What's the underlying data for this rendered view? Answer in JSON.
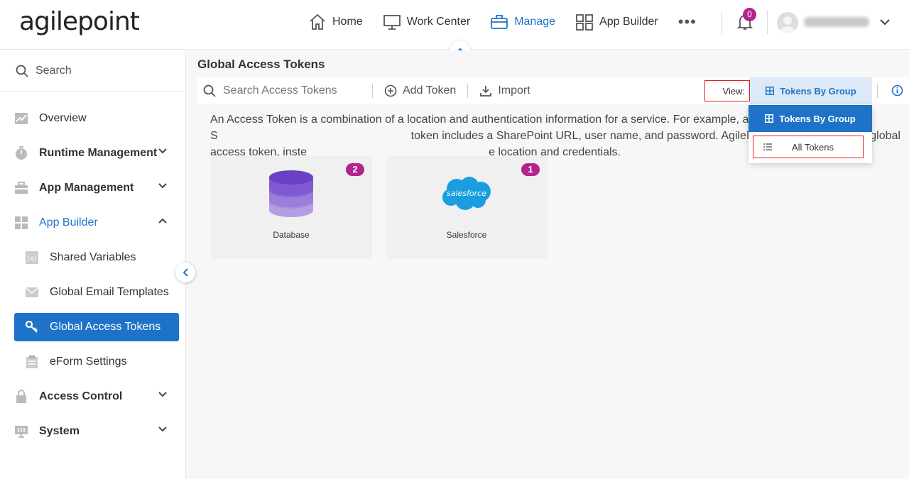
{
  "header": {
    "logo": "agilepoint",
    "nav": [
      {
        "label": "Home",
        "icon": "home-icon"
      },
      {
        "label": "Work Center",
        "icon": "monitor-icon"
      },
      {
        "label": "Manage",
        "icon": "briefcase-icon",
        "active": true
      },
      {
        "label": "App Builder",
        "icon": "grid-icon"
      }
    ],
    "more": "•••",
    "notification_count": "0"
  },
  "sidebar": {
    "search_placeholder": "Search",
    "items": [
      {
        "label": "Overview",
        "icon": "chart-icon"
      },
      {
        "label": "Runtime Management",
        "icon": "stopwatch-icon"
      },
      {
        "label": "App Management",
        "icon": "toolbox-icon"
      },
      {
        "label": "App Builder",
        "icon": "app-builder-icon"
      },
      {
        "label": "Shared Variables",
        "icon": "variable-icon"
      },
      {
        "label": "Global Email Templates",
        "icon": "envelope-icon"
      },
      {
        "label": "Global Access Tokens",
        "icon": "key-icon"
      },
      {
        "label": "eForm Settings",
        "icon": "clipboard-icon"
      },
      {
        "label": "Access Control",
        "icon": "lock-icon"
      },
      {
        "label": "System",
        "icon": "system-icon"
      }
    ]
  },
  "main": {
    "title": "Global Access Tokens",
    "search_placeholder": "Search Access Tokens",
    "add_token": "Add Token",
    "import": "Import",
    "view_label": "View:",
    "view_selected": "Tokens By Group",
    "description": "An Access Token is a combination of a location and authentication information for a service. For example, a S                 token includes a SharePoint URL, user name, and password. AgilePoint users can select a global access token, inste                e location and credentials.",
    "cards": [
      {
        "label": "Database",
        "count": "2"
      },
      {
        "label": "Salesforce",
        "count": "1",
        "logo_text": "salesforce"
      }
    ]
  },
  "dropdown": {
    "options": [
      "Tokens By Group",
      "All Tokens"
    ]
  },
  "colors": {
    "accent": "#1e73c8",
    "badge": "#b3248c",
    "highlight": "#e02020"
  }
}
